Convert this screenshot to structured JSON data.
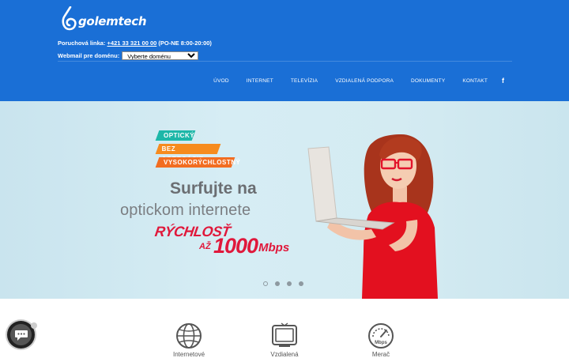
{
  "header": {
    "logo_text": "golemtech",
    "hotline_label": "Poruchová linka:",
    "hotline_number": "+421 33 321 00 00",
    "hotline_hours": "(PO-NE 8:00-20:00)",
    "webmail_label": "Webmail pre doménu:",
    "webmail_select_value": "Vyberte doménu",
    "bg_color": "#1a6fd6"
  },
  "nav": {
    "items": [
      {
        "label": "ÚVOD"
      },
      {
        "label": "INTERNET"
      },
      {
        "label": "TELEVÍZIA"
      },
      {
        "label": "VZDIALENÁ PODPORA"
      },
      {
        "label": "DOKUMENTY"
      },
      {
        "label": "KONTAKT"
      }
    ],
    "facebook_icon": "facebook-icon",
    "facebook_glyph": "f"
  },
  "hero": {
    "tags": [
      "OPTICKÝ",
      "BEZ AGREGÁCIE",
      "VYSOKORÝCHLOSTNÝ"
    ],
    "headline": "Surfujte na",
    "subheadline": "optickom internete",
    "speed_word": "RÝCHLOSŤ",
    "speed_prefix": "AŽ",
    "speed_value": "1000",
    "speed_unit": "Mbps",
    "slide_count": 4,
    "active_slide": 1
  },
  "features": {
    "items": [
      {
        "icon": "globe-icon",
        "label": "Internetové"
      },
      {
        "icon": "tv-icon",
        "label": "Vzdialená"
      },
      {
        "icon": "speedometer-icon",
        "label": "Merač"
      }
    ],
    "speed_icon_text": "Mbps"
  },
  "chat": {
    "icon": "chat-icon"
  }
}
